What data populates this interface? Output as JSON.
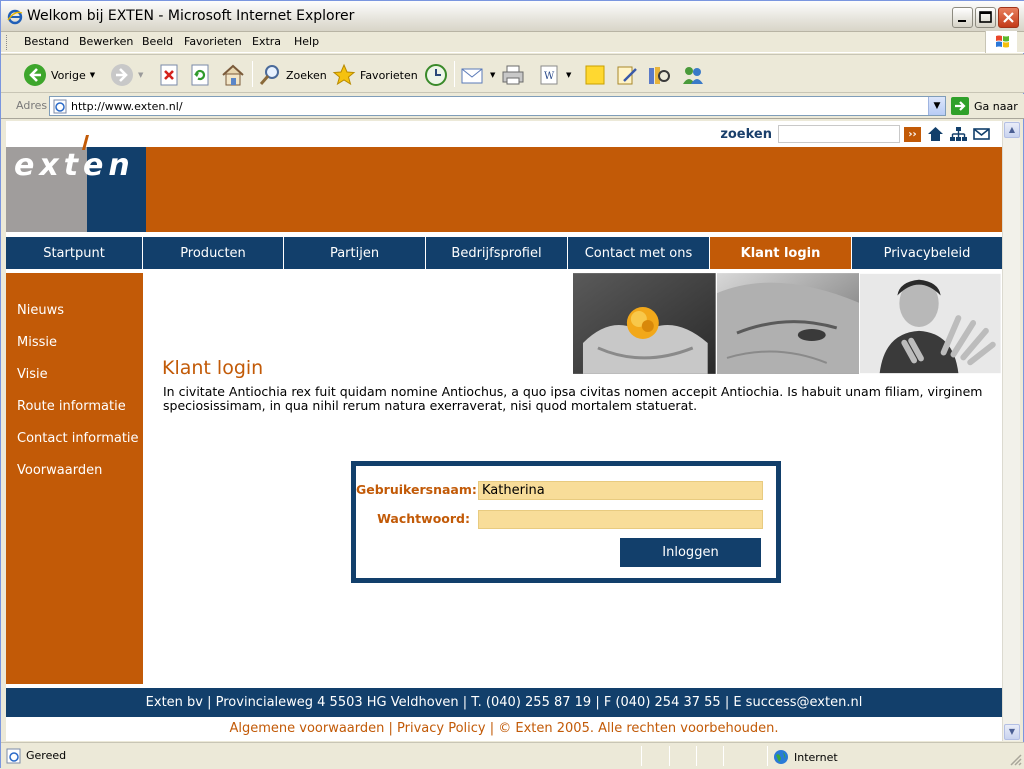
{
  "window": {
    "title": "Welkom bij EXTEN - Microsoft Internet Explorer"
  },
  "menubar": [
    "Bestand",
    "Bewerken",
    "Beeld",
    "Favorieten",
    "Extra",
    "Help"
  ],
  "toolbar": {
    "back_label": "Vorige",
    "search_label": "Zoeken",
    "favorites_label": "Favorieten"
  },
  "address": {
    "label": "Adres",
    "url": "http://www.exten.nl/",
    "go_label": "Ga naar"
  },
  "page": {
    "search_label": "zoeken",
    "search_placeholder": "",
    "logo_text": "exten",
    "nav": [
      "Startpunt",
      "Producten",
      "Partijen",
      "Bedrijfsprofiel",
      "Contact met ons",
      "Klant login",
      "Privacybeleid"
    ],
    "nav_active": "Klant login",
    "sidebar": [
      "Nieuws",
      "Missie",
      "Visie",
      "Route informatie",
      "Contact informatie",
      "Voorwaarden"
    ],
    "title": "Klant login",
    "intro": "In civitate Antiochia rex fuit quidam nomine Antiochus, a quo ipsa civitas nomen accepit Antiochia. Is habuit unam filiam, virginem speciosissimam, in qua nihil rerum natura exerraverat, nisi quod mortalem statuerat.",
    "login": {
      "username_label": "Gebruikersnaam:",
      "username_value": "Katherina",
      "password_label": "Wachtwoord:",
      "password_value": "",
      "button_label": "Inloggen"
    },
    "footer_address": "Exten bv | Provincialeweg 4 5503 HG Veldhoven | T. (040) 255 87 19 | F (040) 254 37 55 | E success@exten.nl",
    "footer_links": "Algemene voorwaarden | Privacy Policy | © Exten 2005. Alle rechten voorbehouden."
  },
  "statusbar": {
    "status": "Gereed",
    "zone": "Internet"
  },
  "colors": {
    "orange": "#c25a07",
    "navy": "#123f6b",
    "field": "#f8dd99",
    "logo_grey": "#a09d9c"
  }
}
